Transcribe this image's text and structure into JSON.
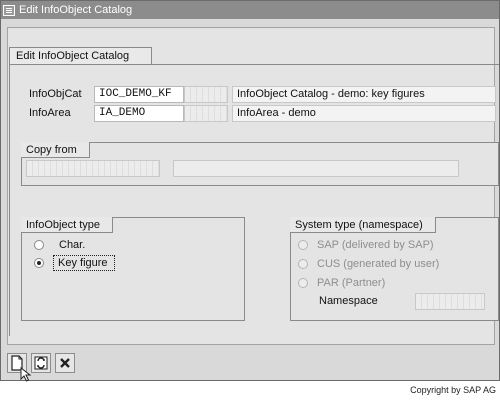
{
  "window": {
    "title": "Edit InfoObject Catalog"
  },
  "main": {
    "tab_label": "Edit InfoObject Catalog",
    "infoobjcat": {
      "label": "InfoObjCat",
      "value": "IOC_DEMO_KF",
      "description": "InfoObject Catalog - demo: key figures"
    },
    "infoarea": {
      "label": "InfoArea",
      "value": "IA_DEMO",
      "description": "InfoArea - demo"
    }
  },
  "copy_from": {
    "label": "Copy from",
    "value": "",
    "description": ""
  },
  "infoobject_type": {
    "label": "InfoObject type",
    "options": [
      {
        "label": "Char.",
        "selected": false
      },
      {
        "label": "Key figure",
        "selected": true
      }
    ]
  },
  "system_type": {
    "label": "System type (namespace)",
    "options": [
      {
        "label": "SAP (delivered by SAP)"
      },
      {
        "label": "CUS (generated by user)"
      },
      {
        "label": "PAR (Partner)"
      }
    ],
    "namespace_label": "Namespace",
    "namespace_value": ""
  },
  "toolbar": {
    "icons": [
      "create-icon",
      "switch-icon",
      "cancel-icon"
    ]
  },
  "copyright": "Copyright by SAP AG"
}
